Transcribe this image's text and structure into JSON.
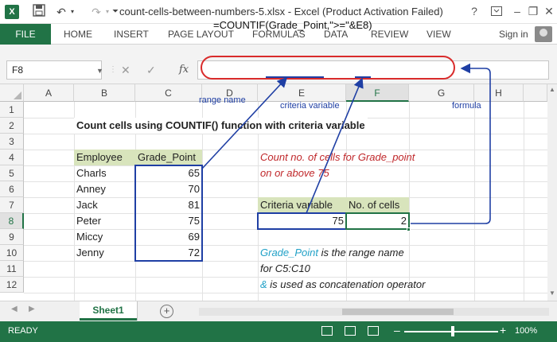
{
  "title_bar": {
    "logo": "X",
    "title": "count-cells-between-numbers-5.xlsx - Excel (Product Activation Failed)",
    "icons": [
      "excel-logo-icon",
      "save-icon",
      "undo-icon",
      "undo-dropdown-icon",
      "redo-icon",
      "redo-dropdown-icon",
      "customize-icon",
      "help-icon",
      "ribbon-display-icon",
      "minimize-icon",
      "maximize-icon",
      "close-icon"
    ],
    "help": "?",
    "minimize": "–",
    "maximize": "❐",
    "close": "✕"
  },
  "ribbon": {
    "tabs": [
      "FILE",
      "HOME",
      "INSERT",
      "PAGE LAYOUT",
      "FORMULAS",
      "DATA",
      "REVIEW",
      "VIEW"
    ],
    "sign_in": "Sign in"
  },
  "formula_bar": {
    "name_box": "F8",
    "fx": "fx",
    "formula": "=COUNTIF(Grade_Point,\">=\"&E8)"
  },
  "columns": [
    "A",
    "B",
    "C",
    "D",
    "E",
    "F",
    "G",
    "H"
  ],
  "rows": [
    "1",
    "2",
    "3",
    "4",
    "5",
    "6",
    "7",
    "8",
    "9",
    "10",
    "11",
    "12"
  ],
  "sheet": {
    "heading": "Count cells using COUNTIF() function with criteria variable",
    "table_headers": [
      "Employee",
      "Grade_Point"
    ],
    "table_rows": [
      {
        "employee": "Charls",
        "grade": "65"
      },
      {
        "employee": "Anney",
        "grade": "70"
      },
      {
        "employee": "Jack",
        "grade": "81"
      },
      {
        "employee": "Peter",
        "grade": "75"
      },
      {
        "employee": "Miccy",
        "grade": "69"
      },
      {
        "employee": "Jenny",
        "grade": "72"
      }
    ],
    "note_line1": "Count no. of cells for Grade_point",
    "note_line2": "on or above 75",
    "criteria_header": "Criteria variable",
    "count_header": "No. of cells",
    "criteria_value": "75",
    "count_value": "2",
    "footnote1_name": "Grade_Point",
    "footnote1_rest": " is the range name",
    "footnote2": "for C5:C10",
    "footnote3_symbol": "&",
    "footnote3_rest": " is used as concatenation operator"
  },
  "annotations": {
    "range_name": "range name",
    "criteria_variable": "criteria variable",
    "formula": "formula",
    "color": "#1f3fa4",
    "oval_color": "#d92b2b"
  },
  "sheet_tabs": {
    "active": "Sheet1",
    "add": "+"
  },
  "status_bar": {
    "status": "READY",
    "zoom": "100%",
    "zoom_minus": "–",
    "zoom_plus": "+"
  },
  "colors": {
    "excel_green": "#217346",
    "header_fill": "#d8e4bc",
    "red_text": "#c0282b",
    "cyan_text": "#21a1c7"
  }
}
